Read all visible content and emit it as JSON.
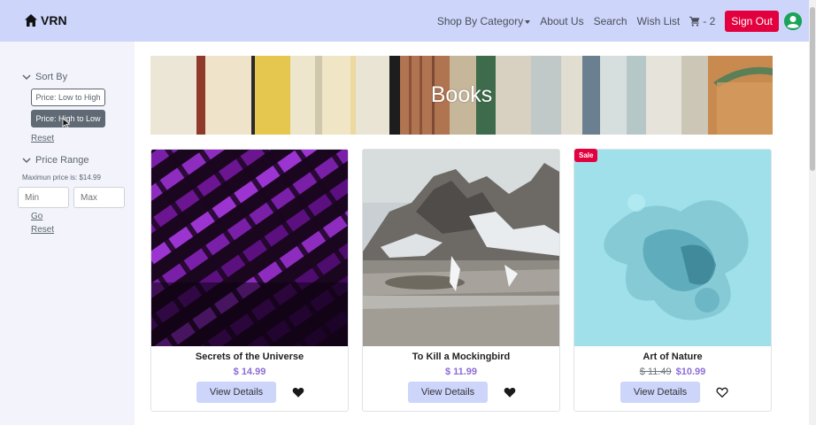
{
  "navbar": {
    "brand": "VRN",
    "links": {
      "shop_by_category": "Shop By Category",
      "about_us": "About Us",
      "search": "Search",
      "wish_list": "Wish List"
    },
    "cart_count": "- 2",
    "sign_out": "Sign Out",
    "icons": [
      "home-icon",
      "cart-icon",
      "user-avatar-icon"
    ]
  },
  "sidebar": {
    "sort_by": {
      "heading": "Sort By",
      "low_to_high": "Price: Low to High",
      "high_to_low": "Price: High to Low",
      "reset": "Reset"
    },
    "price_range": {
      "heading": "Price Range",
      "max_note": "Maximun price is: $14.99",
      "min_placeholder": "Min",
      "max_placeholder": "Max",
      "go": "Go",
      "reset": "Reset"
    }
  },
  "main": {
    "banner_title": "Books",
    "products": [
      {
        "title": "Secrets of the Universe",
        "price": "$ 14.99",
        "old_price": "",
        "details": "View Details",
        "wishlisted": true
      },
      {
        "title": "To Kill a Mockingbird",
        "price": "$ 11.99",
        "old_price": "",
        "details": "View Details",
        "wishlisted": true
      },
      {
        "title": "Art of Nature",
        "price": "$10.99",
        "old_price": "$ 11.49",
        "details": "View Details",
        "wishlisted": false,
        "badge": "Sale"
      }
    ]
  },
  "colors": {
    "navbar": "#cdd5fb",
    "sign_out": "#e3003f",
    "price": "#8c6cd6",
    "avatar": "#1aa35a",
    "sidebar": "#f3f4fb"
  }
}
